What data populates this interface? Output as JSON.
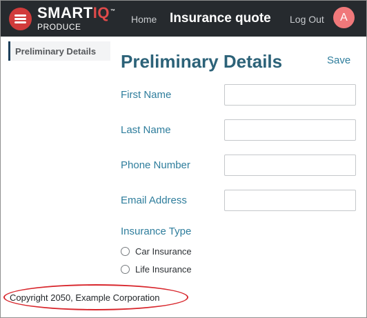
{
  "header": {
    "logo_text": "SMART",
    "logo_text_accent": "IQ",
    "logo_trademark": "™",
    "logo_subtitle": "PRODUCE",
    "home_label": "Home",
    "page_name": "Insurance quote",
    "logout_label": "Log Out",
    "avatar_initial": "A",
    "colors": {
      "bar": "#262a2e",
      "brand": "#d13b3b",
      "avatar": "#f0787a"
    }
  },
  "sidebar": {
    "items": [
      {
        "label": "Preliminary Details",
        "selected": true
      }
    ]
  },
  "main": {
    "title": "Preliminary Details",
    "save_label": "Save",
    "fields": [
      {
        "label": "First Name",
        "value": ""
      },
      {
        "label": "Last Name",
        "value": ""
      },
      {
        "label": "Phone Number",
        "value": ""
      },
      {
        "label": "Email Address",
        "value": ""
      }
    ],
    "insurance_type": {
      "label": "Insurance Type",
      "options": [
        "Car Insurance",
        "Life Insurance"
      ],
      "selected": null
    }
  },
  "footer": {
    "copyright": "Copyright 2050, Example Corporation"
  }
}
